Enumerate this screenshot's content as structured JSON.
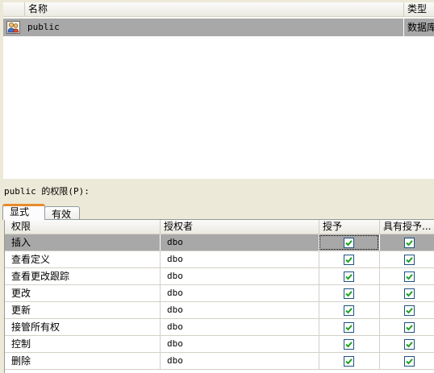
{
  "top_list": {
    "columns": {
      "name": "名称",
      "type": "类型"
    },
    "row": {
      "icon": "user-group-icon",
      "name": "public",
      "type": "数据库"
    }
  },
  "permissions_label": "public 的权限(P):",
  "tabs": [
    {
      "label": "显式",
      "active": true
    },
    {
      "label": "有效",
      "active": false
    }
  ],
  "grid": {
    "columns": {
      "permission": "权限",
      "grantor": "授权者",
      "grant": "授予",
      "with_grant": "具有授予..."
    },
    "rows": [
      {
        "permission": "插入",
        "grantor": "dbo",
        "grant": true,
        "with_grant": true,
        "selected": true
      },
      {
        "permission": "查看定义",
        "grantor": "dbo",
        "grant": true,
        "with_grant": true
      },
      {
        "permission": "查看更改跟踪",
        "grantor": "dbo",
        "grant": true,
        "with_grant": true
      },
      {
        "permission": "更改",
        "grantor": "dbo",
        "grant": true,
        "with_grant": true
      },
      {
        "permission": "更新",
        "grantor": "dbo",
        "grant": true,
        "with_grant": true
      },
      {
        "permission": "接管所有权",
        "grantor": "dbo",
        "grant": true,
        "with_grant": true
      },
      {
        "permission": "控制",
        "grantor": "dbo",
        "grant": true,
        "with_grant": true
      },
      {
        "permission": "删除",
        "grantor": "dbo",
        "grant": true,
        "with_grant": true
      }
    ]
  },
  "colors": {
    "selection": "#a8a8a8",
    "check": "#21a121",
    "tab_accent": "#e68b2c"
  }
}
